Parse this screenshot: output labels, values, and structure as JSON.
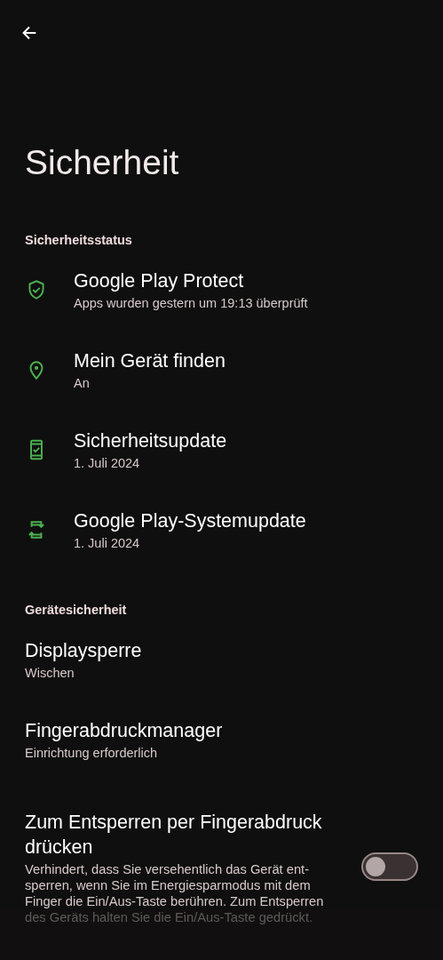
{
  "title": "Sicherheit",
  "sections": [
    {
      "header": "Sicherheitsstatus",
      "items": [
        {
          "kind": "icon",
          "title": "Google Play Protect",
          "subtitle": "Apps wurden gestern um 19:13 überprüft"
        },
        {
          "kind": "icon",
          "title": "Mein Gerät finden",
          "subtitle": "An"
        },
        {
          "kind": "icon",
          "title": "Sicherheitsupdate",
          "subtitle": "1. Juli 2024"
        },
        {
          "kind": "icon",
          "title": "Google Play-Systemupdate",
          "subtitle": "1. Juli 2024"
        }
      ]
    },
    {
      "header": "Gerätesicherheit",
      "items": [
        {
          "kind": "plain",
          "title": "Displaysperre",
          "subtitle": "Wischen"
        },
        {
          "kind": "plain",
          "title": "Fingerabdruckmanager",
          "subtitle": "Einrichtung erforderlich"
        },
        {
          "kind": "toggle",
          "title": "Zum Entsperren per Fingerabdruck drücken",
          "subtitle": "Verhindert, dass Sie versehentlich das Gerät ent-sperren, wenn Sie im Energiesparmodus mit dem Finger die Ein/Aus-Taste berühren. Zum Entsperren des Geräts halten Sie die Ein/Aus-Taste gedrückt.",
          "on": false
        }
      ]
    }
  ]
}
